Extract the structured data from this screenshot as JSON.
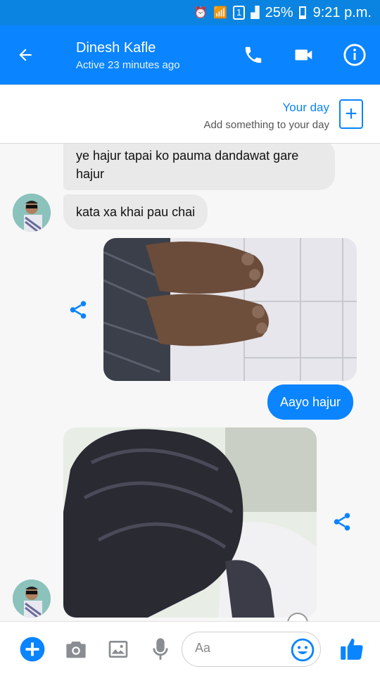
{
  "status_bar": {
    "sim": "1",
    "battery": "25%",
    "time": "9:21 p.m."
  },
  "header": {
    "name": "Dinesh Kafle",
    "status": "Active 23 minutes ago"
  },
  "your_day": {
    "title": "Your day",
    "subtitle": "Add something to your day"
  },
  "messages": [
    {
      "from": "them",
      "text": "ye hajur tapai ko pauma dandawat gare hajur"
    },
    {
      "from": "them",
      "text": "kata xa khai pau chai"
    },
    {
      "from": "me",
      "type": "image",
      "description": "photo"
    },
    {
      "from": "me",
      "text": "Aayo hajur"
    },
    {
      "from": "them",
      "type": "image",
      "description": "photo"
    }
  ],
  "composer": {
    "placeholder": "Aa"
  },
  "colors": {
    "accent": "#0a84ff",
    "incoming_bubble": "#e9e9e9"
  }
}
